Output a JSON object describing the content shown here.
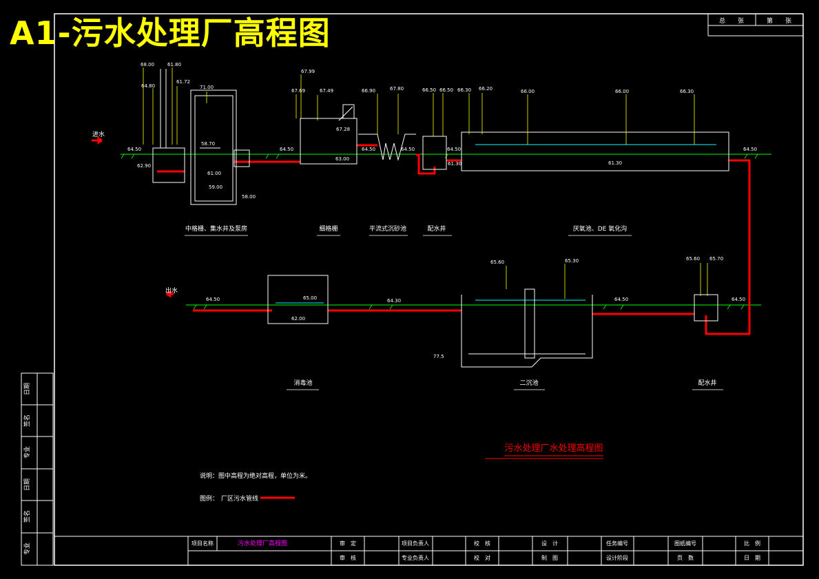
{
  "title": "A1-污水处理厂高程图",
  "corner_table": [
    "总　　张",
    "第　　张"
  ],
  "inlet_label": "进水",
  "outlet_label": "出水",
  "levels": {
    "l6800": "68.00",
    "l6180": "61.80",
    "l6480a": "64.80",
    "l6172": "61.72",
    "l7100": "71.00",
    "l6450a": "64.50",
    "l6290": "62.90",
    "l5870": "58.70",
    "l6100": "61.00",
    "l5900": "59.00",
    "l5800": "58.00",
    "l6450b": "64.50",
    "l6799": "67.99",
    "l6769": "67.69",
    "l6749": "67.49",
    "l6728": "67.28",
    "l6300": "63.00",
    "l6690": "66.90",
    "l6780": "67.80",
    "l6450c": "64.50",
    "l6450d": "64.50",
    "l6650a": "66.50",
    "l6650b": "66.50",
    "l6630a": "66.30",
    "l6620": "66.20",
    "l6450e": "64.50",
    "l6130a": "61.30",
    "l6600": "66.00",
    "l6600b": "66.00",
    "l6630b": "66.30",
    "l6130b": "61.30",
    "l6450f": "64.50",
    "l6450g": "64.50",
    "l6500": "65.00",
    "l6200": "62.00",
    "l6430": "64.30",
    "l6560a": "65.60",
    "l6530": "65.30",
    "l775": "77.5",
    "l6450h": "64.50",
    "l6560b": "65.60",
    "l6570": "65.70",
    "l6450i": "64.50"
  },
  "units": {
    "u1": "中格栅、集水井及泵房",
    "u2": "细格栅",
    "u3": "平流式沉砂池",
    "u4": "配水井",
    "u5": "厌氧池、DE 氧化沟",
    "u6": "消毒池",
    "u7": "二沉池",
    "u8": "配水井"
  },
  "drawing_subtitle": "污水处理厂水处理高程图",
  "note": "说明：图中高程为绝对高程，单位为米。",
  "legend_label": "图例：",
  "legend_item": "厂区污水管线",
  "side_table": [
    "日期",
    "签名",
    "专业",
    "日期",
    "签名",
    "专业"
  ],
  "title_block": {
    "project_name_label": "项目名称",
    "project_name_value": "污水处理厂高程图",
    "c1": "审　定",
    "c2": "审　核",
    "c3": "项目负责人",
    "c4": "专业负责人",
    "c5": "校　核",
    "c6": "校　对",
    "c7": "设　计",
    "c8": "制　图",
    "c9": "任务编号",
    "c10": "设计阶段",
    "c11": "图纸编号",
    "c12": "页　数",
    "c13": "比　例",
    "c14": "日　期"
  },
  "colors": {
    "pipe": "#ff0000",
    "frame": "#ffffff",
    "leader": "#ffff00",
    "ground": "#00ff00",
    "water": "#00ffff",
    "highlight": "#ff00ff"
  }
}
